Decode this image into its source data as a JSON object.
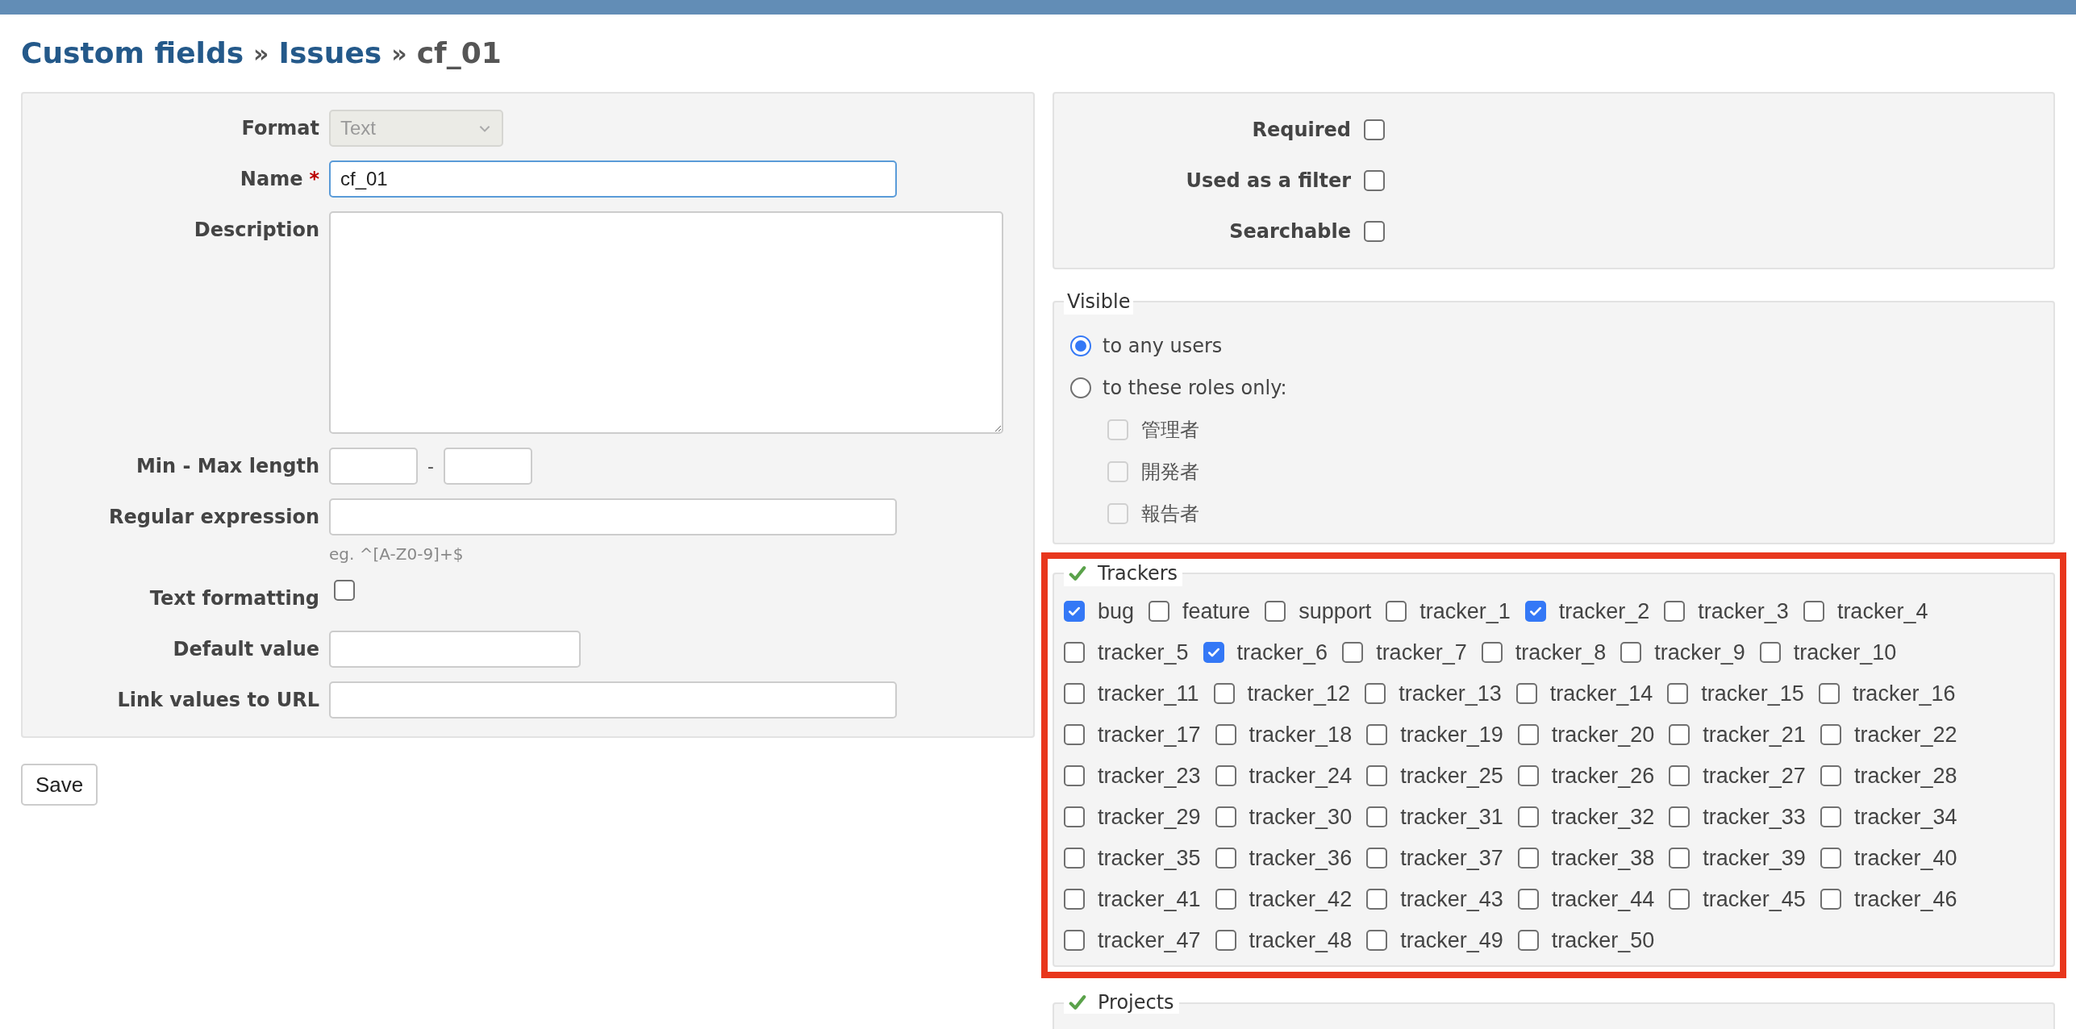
{
  "breadcrumb": [
    {
      "kind": "link",
      "text": "Custom fields"
    },
    {
      "kind": "separator",
      "text": "»"
    },
    {
      "kind": "link",
      "text": "Issues"
    },
    {
      "kind": "separator",
      "text": "»"
    },
    {
      "kind": "current",
      "text": "cf_01"
    }
  ],
  "left_fields": [
    {
      "kind": "select",
      "label": "Format",
      "value": "Text",
      "disabled": true
    },
    {
      "kind": "text",
      "label": "Name",
      "required_mark": "*",
      "value": "cf_01",
      "focused": true
    },
    {
      "kind": "textarea",
      "label": "Description"
    },
    {
      "kind": "range",
      "label": "Min - Max length",
      "separator": "-"
    },
    {
      "kind": "text",
      "label": "Regular expression",
      "hint": "eg. ^[A-Z0-9]+$"
    },
    {
      "kind": "checkbox",
      "label": "Text formatting",
      "checked": false
    },
    {
      "kind": "short_text",
      "label": "Default value"
    },
    {
      "kind": "text",
      "label": "Link values to URL"
    }
  ],
  "save_button": "Save",
  "right_options": [
    {
      "label": "Required",
      "checked": false
    },
    {
      "label": "Used as a filter",
      "checked": false
    },
    {
      "label": "Searchable",
      "checked": false
    }
  ],
  "visible": {
    "legend": "Visible",
    "options": [
      {
        "label": "to any users",
        "selected": true
      },
      {
        "label": "to these roles only:",
        "selected": false
      }
    ],
    "roles": [
      {
        "label": "管理者",
        "checked": false,
        "disabled": true
      },
      {
        "label": "開発者",
        "checked": false,
        "disabled": true
      },
      {
        "label": "報告者",
        "checked": false,
        "disabled": true
      }
    ]
  },
  "trackers": {
    "legend": "Trackers",
    "items": [
      {
        "label": "bug",
        "checked": true
      },
      {
        "label": "feature",
        "checked": false
      },
      {
        "label": "support",
        "checked": false
      },
      {
        "label": "tracker_1",
        "checked": false
      },
      {
        "label": "tracker_2",
        "checked": true
      },
      {
        "label": "tracker_3",
        "checked": false
      },
      {
        "label": "tracker_4",
        "checked": false
      },
      {
        "label": "tracker_5",
        "checked": false
      },
      {
        "label": "tracker_6",
        "checked": true
      },
      {
        "label": "tracker_7",
        "checked": false
      },
      {
        "label": "tracker_8",
        "checked": false
      },
      {
        "label": "tracker_9",
        "checked": false
      },
      {
        "label": "tracker_10",
        "checked": false
      },
      {
        "label": "tracker_11",
        "checked": false
      },
      {
        "label": "tracker_12",
        "checked": false
      },
      {
        "label": "tracker_13",
        "checked": false
      },
      {
        "label": "tracker_14",
        "checked": false
      },
      {
        "label": "tracker_15",
        "checked": false
      },
      {
        "label": "tracker_16",
        "checked": false
      },
      {
        "label": "tracker_17",
        "checked": false
      },
      {
        "label": "tracker_18",
        "checked": false
      },
      {
        "label": "tracker_19",
        "checked": false
      },
      {
        "label": "tracker_20",
        "checked": false
      },
      {
        "label": "tracker_21",
        "checked": false
      },
      {
        "label": "tracker_22",
        "checked": false
      },
      {
        "label": "tracker_23",
        "checked": false
      },
      {
        "label": "tracker_24",
        "checked": false
      },
      {
        "label": "tracker_25",
        "checked": false
      },
      {
        "label": "tracker_26",
        "checked": false
      },
      {
        "label": "tracker_27",
        "checked": false
      },
      {
        "label": "tracker_28",
        "checked": false
      },
      {
        "label": "tracker_29",
        "checked": false
      },
      {
        "label": "tracker_30",
        "checked": false
      },
      {
        "label": "tracker_31",
        "checked": false
      },
      {
        "label": "tracker_32",
        "checked": false
      },
      {
        "label": "tracker_33",
        "checked": false
      },
      {
        "label": "tracker_34",
        "checked": false
      },
      {
        "label": "tracker_35",
        "checked": false
      },
      {
        "label": "tracker_36",
        "checked": false
      },
      {
        "label": "tracker_37",
        "checked": false
      },
      {
        "label": "tracker_38",
        "checked": false
      },
      {
        "label": "tracker_39",
        "checked": false
      },
      {
        "label": "tracker_40",
        "checked": false
      },
      {
        "label": "tracker_41",
        "checked": false
      },
      {
        "label": "tracker_42",
        "checked": false
      },
      {
        "label": "tracker_43",
        "checked": false
      },
      {
        "label": "tracker_44",
        "checked": false
      },
      {
        "label": "tracker_45",
        "checked": false
      },
      {
        "label": "tracker_46",
        "checked": false
      },
      {
        "label": "tracker_47",
        "checked": false
      },
      {
        "label": "tracker_48",
        "checked": false
      },
      {
        "label": "tracker_49",
        "checked": false
      },
      {
        "label": "tracker_50",
        "checked": false
      }
    ]
  },
  "projects": {
    "legend": "Projects"
  }
}
